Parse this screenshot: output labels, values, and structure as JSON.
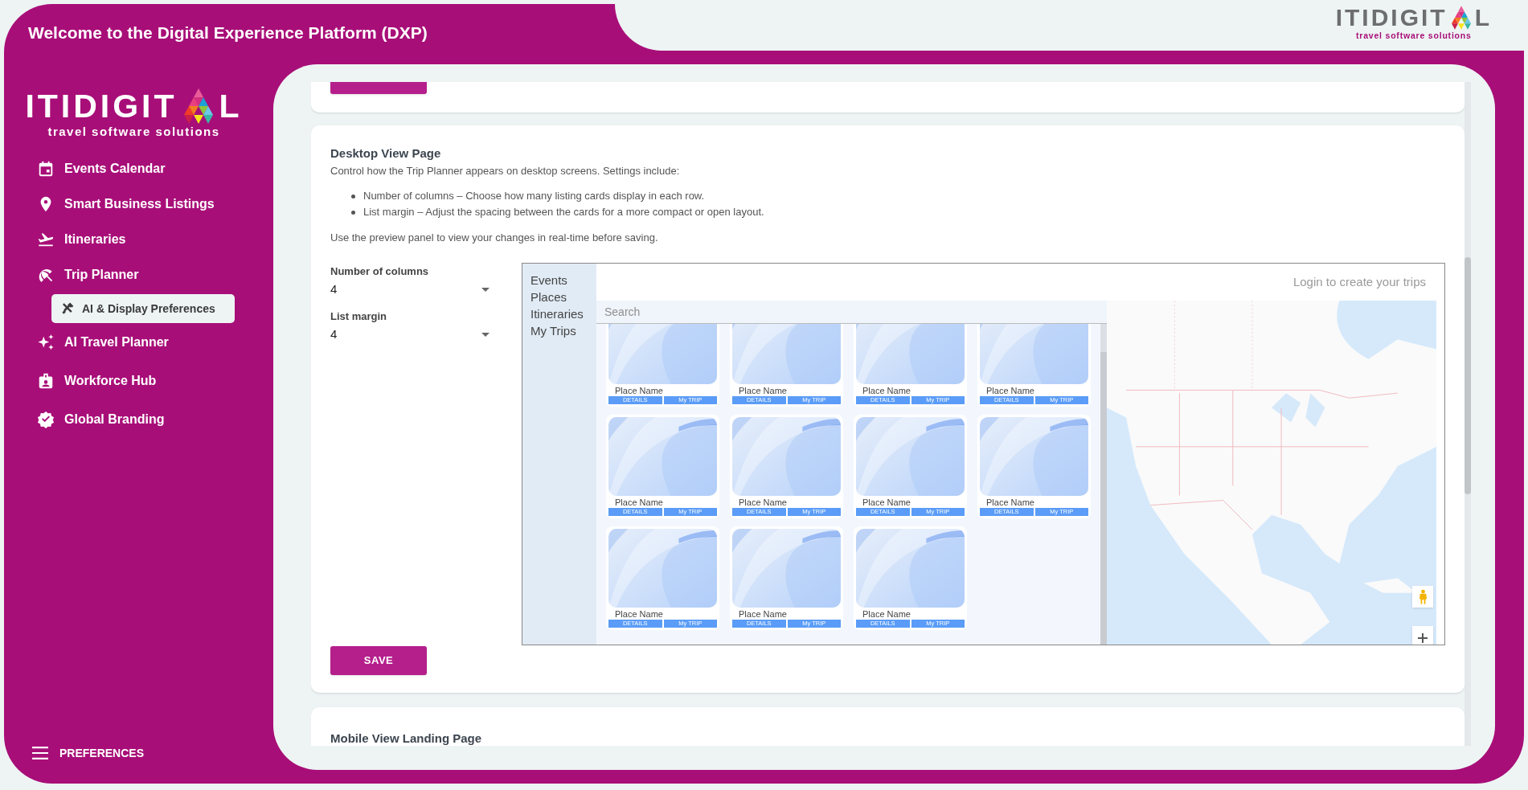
{
  "header": {
    "title": "Welcome to the Digital Experience Platform (DXP)"
  },
  "top_logo": {
    "wordmark_start": "ITIDIGIT",
    "wordmark_end": "L",
    "tagline": "travel software solutions"
  },
  "sidebar": {
    "logo": {
      "wordmark_start": "ITIDIGIT",
      "wordmark_end": "L",
      "tagline": "travel software solutions"
    },
    "items": [
      {
        "label": "Events Calendar",
        "selected": false
      },
      {
        "label": "Smart Business Listings",
        "selected": false
      },
      {
        "label": "Itineraries",
        "selected": false
      },
      {
        "label": "Trip Planner",
        "selected": false,
        "children": [
          {
            "label": "AI & Display Preferences",
            "selected": true
          }
        ]
      },
      {
        "label": "AI Travel Planner",
        "selected": false
      },
      {
        "label": "Workforce Hub",
        "selected": false
      },
      {
        "label": "Global Branding",
        "selected": false
      }
    ],
    "footer": {
      "label": "PREFERENCES"
    }
  },
  "desktop_view_card": {
    "title": "Desktop View Page",
    "description": "Control how the Trip Planner appears on desktop screens. Settings include:",
    "bullets": [
      "Number of columns – Choose how many listing cards display in each row.",
      "List margin – Adjust the spacing between the cards for a more compact or open layout."
    ],
    "note": "Use the preview panel to view your changes in real-time before saving.",
    "fields": [
      {
        "label": "Number of columns",
        "value": "4"
      },
      {
        "label": "List margin",
        "value": "4"
      }
    ],
    "preview": {
      "nav": [
        "Events",
        "Places",
        "Itineraries",
        "My Trips"
      ],
      "login_text": "Login to create your trips",
      "search_placeholder": "Search",
      "cards": [
        {
          "name": "Place Name",
          "buttons": [
            "DETAILS",
            "My TRIP"
          ]
        },
        {
          "name": "Place Name",
          "buttons": [
            "DETAILS",
            "My TRIP"
          ]
        },
        {
          "name": "Place Name",
          "buttons": [
            "DETAILS",
            "My TRIP"
          ]
        },
        {
          "name": "Place Name",
          "buttons": [
            "DETAILS",
            "My TRIP"
          ]
        },
        {
          "name": "Place Name",
          "buttons": [
            "DETAILS",
            "My TRIP"
          ]
        },
        {
          "name": "Place Name",
          "buttons": [
            "DETAILS",
            "My TRIP"
          ]
        },
        {
          "name": "Place Name",
          "buttons": [
            "DETAILS",
            "My TRIP"
          ]
        },
        {
          "name": "Place Name",
          "buttons": [
            "DETAILS",
            "My TRIP"
          ]
        },
        {
          "name": "Place Name",
          "buttons": [
            "DETAILS",
            "My TRIP"
          ]
        },
        {
          "name": "Place Name",
          "buttons": [
            "DETAILS",
            "My TRIP"
          ]
        },
        {
          "name": "Place Name",
          "buttons": [
            "DETAILS",
            "My TRIP"
          ]
        }
      ]
    },
    "save_button": "SAVE"
  },
  "next_card": {
    "title": "Mobile View Landing Page"
  }
}
